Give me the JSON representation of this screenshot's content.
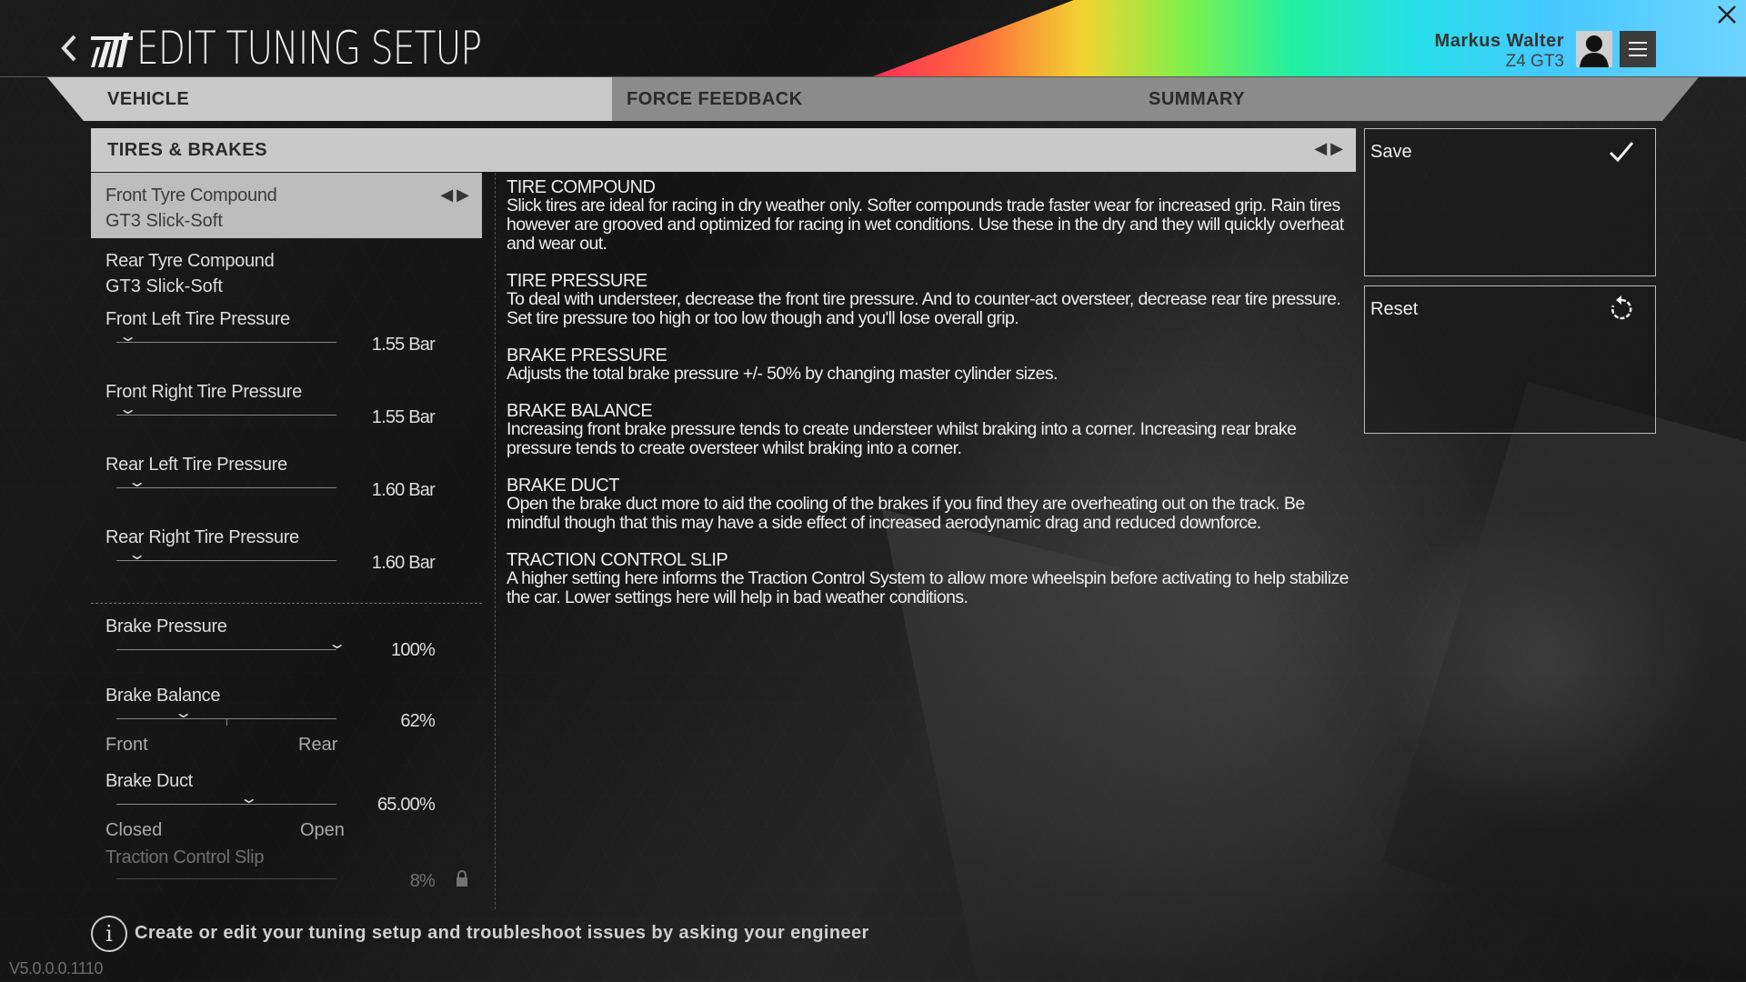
{
  "header": {
    "title": "EDIT TUNING SETUP",
    "user_name": "Markus Walter",
    "user_car": "Z4 GT3",
    "icons": {
      "back": "chevron-left-icon",
      "menu": "hamburger-menu-icon",
      "close": "close-icon"
    }
  },
  "tabs": [
    {
      "label": "VEHICLE",
      "active": true
    },
    {
      "label": "FORCE FEEDBACK",
      "active": false
    },
    {
      "label": "SUMMARY",
      "active": false
    }
  ],
  "section": {
    "title": "TIRES & BRAKES"
  },
  "settings": {
    "front_tyre": {
      "label": "Front Tyre Compound",
      "value": "GT3 Slick-Soft"
    },
    "rear_tyre": {
      "label": "Rear Tyre Compound",
      "value": "GT3 Slick-Soft"
    },
    "fl_pressure": {
      "label": "Front Left Tire Pressure",
      "value": "1.55 Bar",
      "level": 0.05
    },
    "fr_pressure": {
      "label": "Front Right Tire Pressure",
      "value": "1.55 Bar",
      "level": 0.05
    },
    "rl_pressure": {
      "label": "Rear Left Tire Pressure",
      "value": "1.60 Bar",
      "level": 0.09
    },
    "rr_pressure": {
      "label": "Rear Right Tire Pressure",
      "value": "1.60 Bar",
      "level": 0.09
    },
    "brake_pressure": {
      "label": "Brake Pressure",
      "value": "100%",
      "level": 1.0
    },
    "brake_balance": {
      "label": "Brake Balance",
      "value": "62%",
      "min_label": "Front",
      "max_label": "Rear",
      "level": 0.3
    },
    "brake_duct": {
      "label": "Brake Duct",
      "value": "65.00%",
      "min_label": "Closed",
      "max_label": "Open",
      "level": 0.6
    },
    "traction_slip": {
      "label": "Traction Control Slip",
      "value": "8%",
      "locked": true
    }
  },
  "descriptions": [
    {
      "title": "TIRE COMPOUND",
      "text": "Slick tires are ideal for racing in dry weather only. Softer compounds trade faster wear for increased grip. Rain tires however are grooved and optimized for racing in wet conditions. Use these in the dry and they will quickly overheat and wear out."
    },
    {
      "title": "TIRE PRESSURE",
      "text": "To deal with understeer, decrease the front tire pressure. And to counter-act oversteer, decrease rear tire pressure. Set tire pressure too high or too low though and you'll lose overall grip."
    },
    {
      "title": "BRAKE PRESSURE",
      "text": "Adjusts the total brake pressure +/- 50% by changing master cylinder sizes."
    },
    {
      "title": "BRAKE BALANCE",
      "text": "Increasing front brake pressure tends to create understeer whilst braking into a corner. Increasing rear brake pressure tends to create oversteer whilst braking into a corner."
    },
    {
      "title": "BRAKE DUCT",
      "text": "Open the brake duct more to aid the cooling of the brakes if you find they are overheating out on the track. Be mindful though that this may have a side effect of increased aerodynamic drag and reduced downforce."
    },
    {
      "title": "TRACTION CONTROL SLIP",
      "text": "A higher setting here informs the Traction Control System to allow more wheelspin before activating to help stabilize the car. Lower settings here will help in bad weather conditions."
    }
  ],
  "actions": {
    "save_label": "Save",
    "reset_label": "Reset"
  },
  "footer": {
    "hint": "Create or edit your tuning setup and troubleshoot issues by asking your engineer",
    "version": "V5.0.0.0.1110"
  }
}
